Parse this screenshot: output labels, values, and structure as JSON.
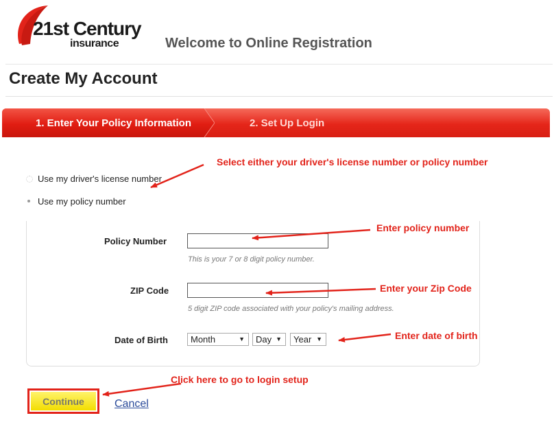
{
  "brand": {
    "logo_main": "21st Century",
    "logo_sub": "insurance",
    "logo_name": "21st-century-swoosh-logo",
    "accent": "#e2231a"
  },
  "header": {
    "welcome": "Welcome to Online Registration"
  },
  "page": {
    "title": "Create My Account"
  },
  "steps": [
    {
      "label": "1. Enter Your Policy Information",
      "active": true
    },
    {
      "label": "2. Set Up Login",
      "active": false
    }
  ],
  "lookup_options": [
    {
      "label": "Use my driver's license number",
      "selected": false
    },
    {
      "label": "Use my policy number",
      "selected": true
    }
  ],
  "form": {
    "policy_number": {
      "label": "Policy Number",
      "value": "",
      "hint": "This is your 7 or 8 digit policy number."
    },
    "zip_code": {
      "label": "ZIP Code",
      "value": "",
      "hint": "5 digit ZIP code associated with your policy's mailing address."
    },
    "date_of_birth": {
      "label": "Date of Birth",
      "month": "Month",
      "day": "Day",
      "year": "Year"
    }
  },
  "annotations": {
    "select_option": "Select either your driver's license number or policy number",
    "policy_number": "Enter policy number",
    "zip_code": "Enter your Zip Code",
    "date_of_birth": "Enter date of birth",
    "continue": "Click here to go to login setup"
  },
  "actions": {
    "continue_label": "Continue",
    "cancel_label": "Cancel"
  }
}
